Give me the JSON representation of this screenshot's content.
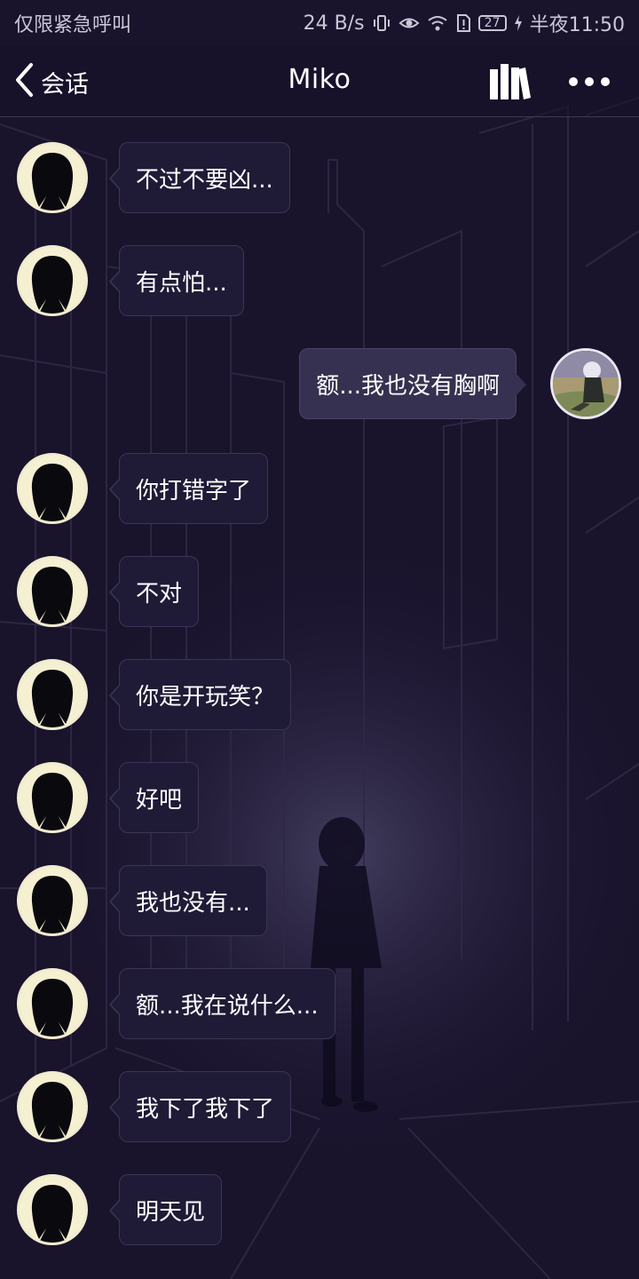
{
  "status_bar": {
    "carrier": "仅限紧急呼叫",
    "speed": "24 B/s",
    "battery": "27",
    "time": "半夜11:50"
  },
  "header": {
    "back_label": "会话",
    "title": "Miko"
  },
  "messages": [
    {
      "side": "left",
      "text": "不过不要凶..."
    },
    {
      "side": "left",
      "text": "有点怕..."
    },
    {
      "side": "right",
      "text": "额...我也没有胸啊"
    },
    {
      "side": "left",
      "text": "你打错字了"
    },
    {
      "side": "left",
      "text": "不对"
    },
    {
      "side": "left",
      "text": "你是开玩笑？"
    },
    {
      "side": "left",
      "text": "好吧"
    },
    {
      "side": "left",
      "text": "我也没有..."
    },
    {
      "side": "left",
      "text": "额...我在说什么..."
    },
    {
      "side": "left",
      "text": "我下了我下了"
    },
    {
      "side": "left",
      "text": "明天见"
    }
  ],
  "icons": {
    "back": "chevron-left-icon",
    "library": "books-icon",
    "more": "more-dots-icon"
  },
  "colors": {
    "background": "#1b1530",
    "bubble": "#1f1b37",
    "bubble_self": "#363150",
    "avatar_bg": "#f6f0d3"
  }
}
